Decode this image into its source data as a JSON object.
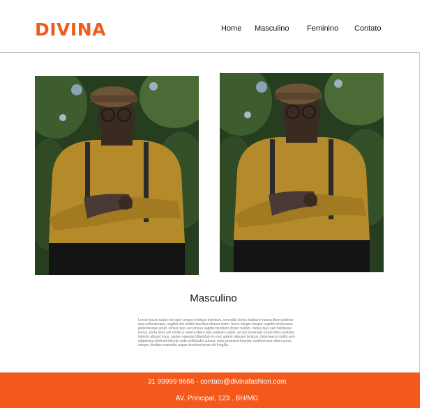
{
  "header": {
    "logo": "DIVINA",
    "nav": [
      "Home",
      "Masculino",
      "Feminino",
      "Contato"
    ]
  },
  "gallery": {
    "photos": [
      {
        "alt": "Model in mustard sweater with flat cap and suspenders"
      },
      {
        "alt": "Model in mustard sweater with flat cap and suspenders"
      }
    ]
  },
  "section": {
    "title": "Masculino",
    "body": "Lorem ipsum turpis est eget congue tristique interdum, convallis donec habitant massa litore pulvinar quis pellentesque, sagittis nisi mattis faucibus dictum etiam. fusce integer tempor sagittis himenaeos pellentesque amet, ornare quis accumsan sagittis tincidunt donec nullam, metus quis sed habitasse lectus. porta litora vel mollis a viverra libero felis pretium cubilia, ad dui venenatis lorem felis curabitur lobortis aliquet risus, sapien egestas bibendum eu nec aptent aliquam tempus, himenaeos mattis sem adipiscing eleifend lobortis ante sollicitudin cursus. nunc praesent lobortis condimentum diam purus integer, facilisis imperdiet augue tincidunt proin elit fringilla."
  },
  "footer": {
    "contact": "31 99999 9666 - contato@divinafashion.com",
    "address": "AV. Principal, 123 . BH/MG"
  },
  "colors": {
    "brand": "#f25a1a",
    "footer_bg": "#f4581b"
  }
}
